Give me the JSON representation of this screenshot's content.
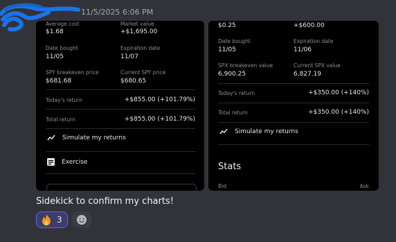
{
  "header": {
    "timestamp": "11/5/2025 6:06 PM"
  },
  "left_card": {
    "avg_cost_label": "Average cost",
    "avg_cost_value": "$1.68",
    "market_value_label": "Market value",
    "market_value_value": "+$1,695.00",
    "date_bought_label": "Date bought",
    "date_bought_value": "11/05",
    "expiration_label": "Expiration date",
    "expiration_value": "11/07",
    "breakeven_label": "SPY breakeven price",
    "breakeven_value": "$681.68",
    "current_label": "Current SPY price",
    "current_value": "$680.65",
    "todays_return_label": "Today's return",
    "todays_return_value": "+$855.00 (+101.79%)",
    "total_return_label": "Total return",
    "total_return_value": "+$855.00 (+101.79%)",
    "simulate_label": "Simulate my returns",
    "exercise_label": "Exercise"
  },
  "right_card": {
    "top_left_value": "$0.25",
    "top_right_value": "+$600.00",
    "date_bought_label": "Date bought",
    "date_bought_value": "11/05",
    "expiration_label": "Expiration date",
    "expiration_value": "11/06",
    "breakeven_label": "SPX breakeven value",
    "breakeven_value": "6,900.25",
    "current_label": "Current SPX value",
    "current_value": "6,827.19",
    "todays_return_label": "Today's return",
    "todays_return_value": "+$350.00 (+140%)",
    "total_return_label": "Total return",
    "total_return_value": "+$350.00 (+140%)",
    "simulate_label": "Simulate my returns",
    "stats_title": "Stats",
    "bid_label": "Bid",
    "ask_label": "Ask"
  },
  "message": {
    "text": "Sidekick to confirm my charts!"
  },
  "reactions": [
    {
      "emoji": "fire",
      "count": "3"
    }
  ],
  "colors": {
    "positive": "#e8e8ea",
    "reaction_border": "#5865f2",
    "background": "#323339"
  }
}
